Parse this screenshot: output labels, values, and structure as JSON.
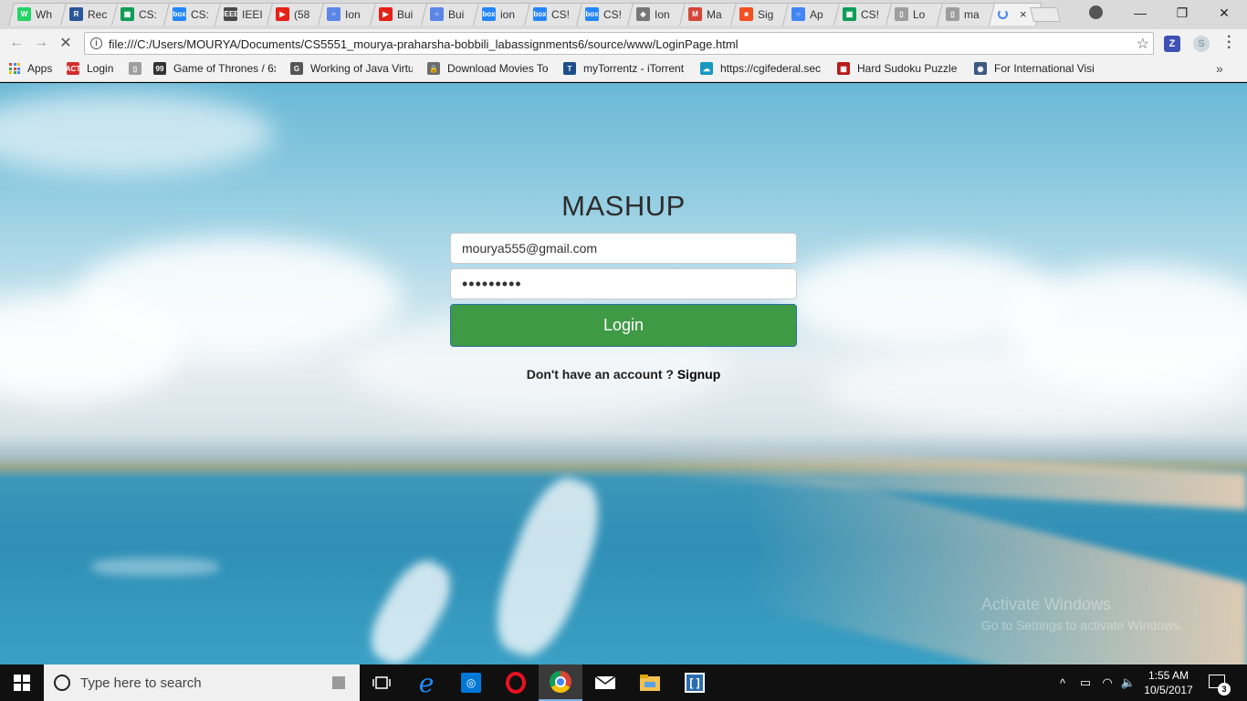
{
  "tabs": [
    {
      "title": "Wh",
      "icon": "whatsapp-icon",
      "color": "#25d366",
      "glyph": "W"
    },
    {
      "title": "Rec",
      "icon": "r-icon",
      "color": "#2b579a",
      "glyph": "R"
    },
    {
      "title": "CS:",
      "icon": "sheets-icon",
      "color": "#0f9d58",
      "glyph": "▦"
    },
    {
      "title": "CS:",
      "icon": "box-icon",
      "color": "#2486fc",
      "glyph": "box"
    },
    {
      "title": "IEEI",
      "icon": "ieee-icon",
      "color": "#4a4a4a",
      "glyph": "IEEE"
    },
    {
      "title": "(58",
      "icon": "youtube-icon",
      "color": "#e62117",
      "glyph": "▶"
    },
    {
      "title": "Ion",
      "icon": "ring-icon",
      "color": "#5b86e5",
      "glyph": "○"
    },
    {
      "title": "Bui",
      "icon": "youtube-icon",
      "color": "#e62117",
      "glyph": "▶"
    },
    {
      "title": "Bui",
      "icon": "ring-icon",
      "color": "#5b86e5",
      "glyph": "○"
    },
    {
      "title": "ion",
      "icon": "box-icon",
      "color": "#2486fc",
      "glyph": "box"
    },
    {
      "title": "CS!",
      "icon": "box-icon",
      "color": "#2486fc",
      "glyph": "box"
    },
    {
      "title": "CS!",
      "icon": "box-icon",
      "color": "#2486fc",
      "glyph": "box"
    },
    {
      "title": "Ion",
      "icon": "diamond-icon",
      "color": "#777777",
      "glyph": "◈"
    },
    {
      "title": "Ma",
      "icon": "gmail-icon",
      "color": "#d44638",
      "glyph": "M"
    },
    {
      "title": "Sig",
      "icon": "microsoft-icon",
      "color": "#f25022",
      "glyph": "■"
    },
    {
      "title": "Ap",
      "icon": "ring-icon",
      "color": "#4285f4",
      "glyph": "○"
    },
    {
      "title": "CS!",
      "icon": "sheets-icon",
      "color": "#0f9d58",
      "glyph": "▦"
    },
    {
      "title": "Lo",
      "icon": "page-icon",
      "color": "#9e9e9e",
      "glyph": "▯"
    },
    {
      "title": "ma",
      "icon": "page-icon",
      "color": "#9e9e9e",
      "glyph": "▯"
    }
  ],
  "active_tab": {
    "title": "",
    "close": "×"
  },
  "address_bar": {
    "url": "file:///C:/Users/MOURYA/Documents/CS5551_mourya-praharsha-bobbili_labassignments6/source/www/LoginPage.html"
  },
  "bookmarks": [
    {
      "label": "Apps",
      "icon": "apps-grid-icon"
    },
    {
      "label": "Login",
      "icon": "act-icon",
      "color": "#d32f2f",
      "glyph": "ACT"
    },
    {
      "label": "",
      "icon": "page-icon",
      "color": "#9e9e9e",
      "glyph": "▯"
    },
    {
      "label": "Game of Thrones / 6x",
      "icon": "quote-icon",
      "color": "#333333",
      "glyph": "99"
    },
    {
      "label": "Working of Java Virtu",
      "icon": "swirl-icon",
      "color": "#555555",
      "glyph": "G"
    },
    {
      "label": "Download Movies To",
      "icon": "lock-icon",
      "color": "#6d6d6d",
      "glyph": "🔒"
    },
    {
      "label": "myTorrentz - iTorrent",
      "icon": "t-icon",
      "color": "#1d4e89",
      "glyph": "T"
    },
    {
      "label": "https://cgifederal.sec",
      "icon": "cloud-icon",
      "color": "#1798c1",
      "glyph": "☁"
    },
    {
      "label": "Hard Sudoku Puzzle",
      "icon": "sudoku-icon",
      "color": "#b71c1c",
      "glyph": "▦"
    },
    {
      "label": "For International Visi",
      "icon": "seal-icon",
      "color": "#3d5a80",
      "glyph": "◉"
    }
  ],
  "page": {
    "title": "MASHUP",
    "email_value": "mourya555@gmail.com",
    "password_value": "•••••••••",
    "login_label": "Login",
    "signup_prompt": "Don't have an account ?",
    "signup_link": "Signup",
    "watermark_1": "Activate Windows",
    "watermark_2": "Go to Settings to activate Windows."
  },
  "taskbar": {
    "search_placeholder": "Type here to search",
    "time": "1:55 AM",
    "date": "10/5/2017",
    "notification_count": "3"
  },
  "colors": {
    "login_button": "#3f9a46",
    "tab_strip": "#dadada",
    "taskbar": "#101010"
  }
}
